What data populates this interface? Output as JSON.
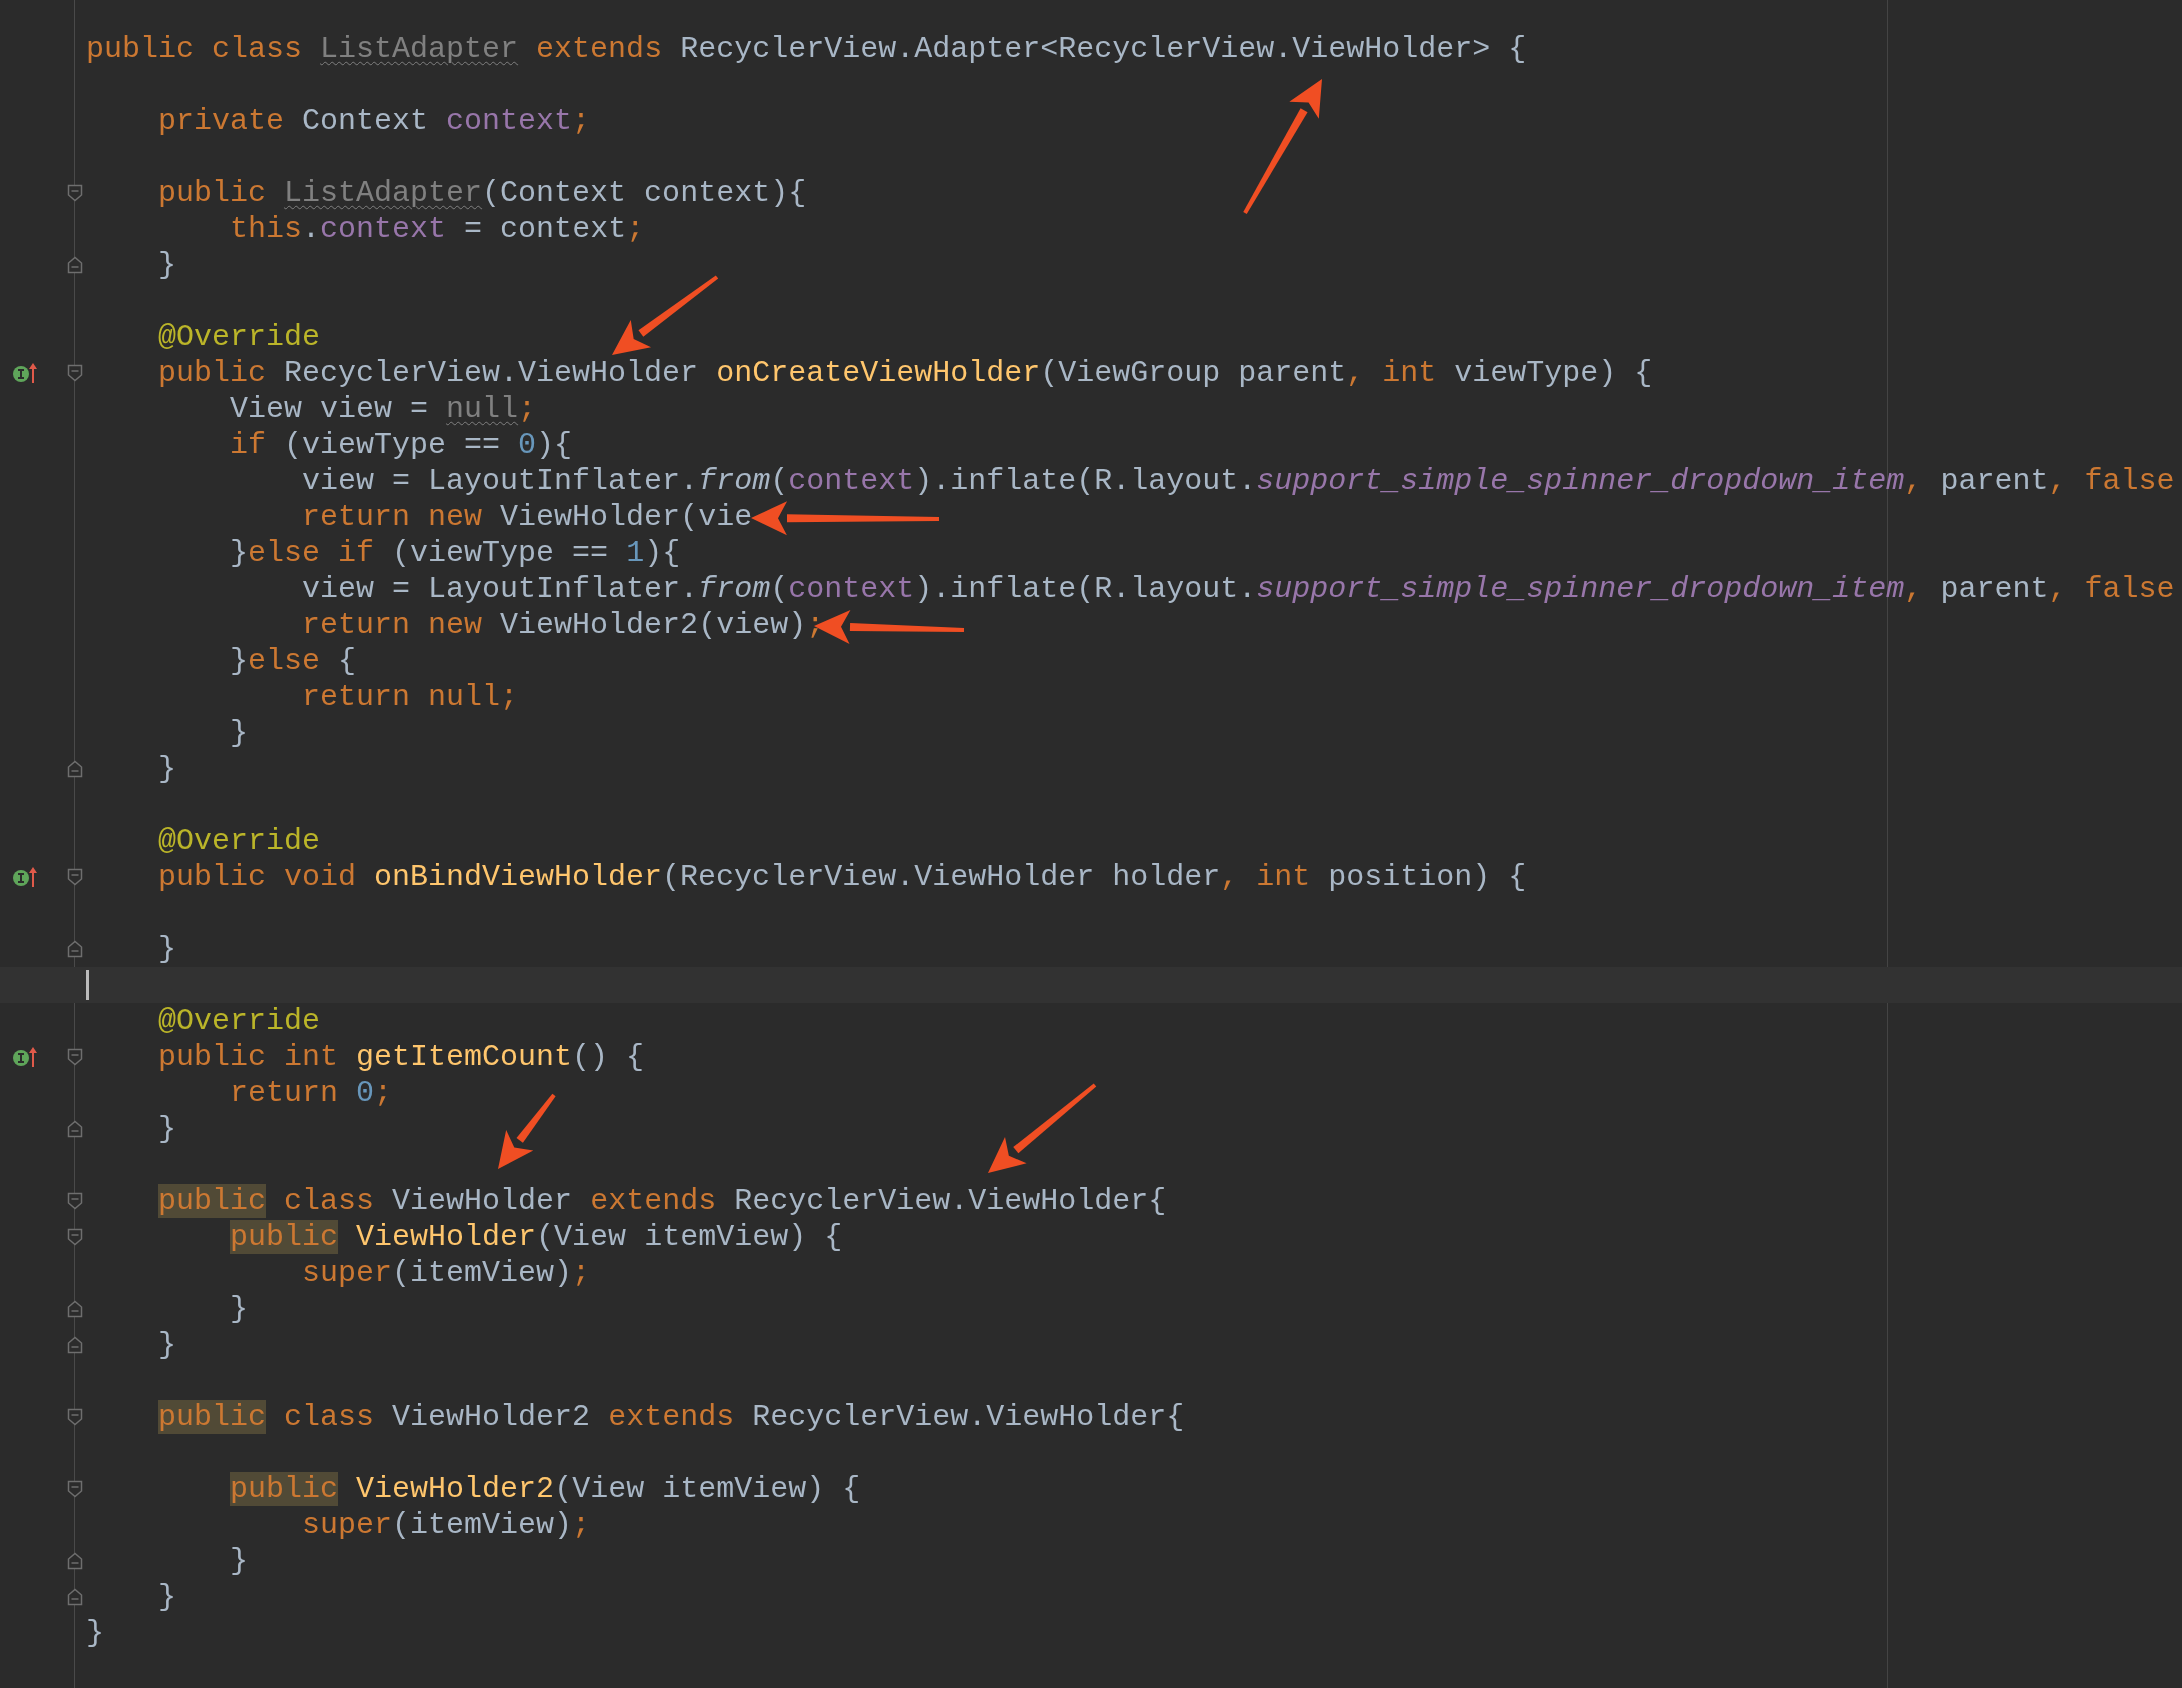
{
  "editor": {
    "lines": [
      {
        "tokens": [
          {
            "text": "public class ",
            "kind": "kw"
          },
          {
            "text": "ListAdapter",
            "kind": "unused"
          },
          {
            "text": " extends ",
            "kind": "kw"
          },
          {
            "text": "RecyclerView.Adapter<RecyclerView.ViewHolder> {",
            "kind": "plain"
          }
        ]
      },
      {
        "kind": "blank"
      },
      {
        "tokens": [
          {
            "text": "    private ",
            "kind": "kw"
          },
          {
            "text": "Context ",
            "kind": "plain"
          },
          {
            "text": "context",
            "kind": "field"
          },
          {
            "text": ";",
            "kind": "kw"
          }
        ]
      },
      {
        "kind": "blank"
      },
      {
        "fold_start": true,
        "tokens": [
          {
            "text": "    public ",
            "kind": "kw"
          },
          {
            "text": "ListAdapter",
            "kind": "unused"
          },
          {
            "text": "(Context context){",
            "kind": "plain"
          }
        ]
      },
      {
        "tokens": [
          {
            "text": "        this",
            "kind": "kw"
          },
          {
            "text": ".",
            "kind": "plain"
          },
          {
            "text": "context",
            "kind": "field"
          },
          {
            "text": " = context",
            "kind": "plain"
          },
          {
            "text": ";",
            "kind": "kw"
          }
        ]
      },
      {
        "fold_end": true,
        "tokens": [
          {
            "text": "    }",
            "kind": "plain"
          }
        ]
      },
      {
        "kind": "blank"
      },
      {
        "tokens": [
          {
            "text": "    @Override",
            "kind": "ann"
          }
        ]
      },
      {
        "override": true,
        "fold_start": true,
        "tokens": [
          {
            "text": "    public ",
            "kind": "kw"
          },
          {
            "text": "RecyclerView.ViewHolder ",
            "kind": "plain"
          },
          {
            "text": "onCreateViewHolder",
            "kind": "decl"
          },
          {
            "text": "(ViewGroup parent",
            "kind": "plain"
          },
          {
            "text": ", int ",
            "kind": "kw"
          },
          {
            "text": "viewType) {",
            "kind": "plain"
          }
        ]
      },
      {
        "tokens": [
          {
            "text": "        View view = ",
            "kind": "plain"
          },
          {
            "text": "null",
            "kind": "unused"
          },
          {
            "text": ";",
            "kind": "kw"
          }
        ]
      },
      {
        "tokens": [
          {
            "text": "        if ",
            "kind": "kw"
          },
          {
            "text": "(viewType == ",
            "kind": "plain"
          },
          {
            "text": "0",
            "kind": "num"
          },
          {
            "text": "){",
            "kind": "plain"
          }
        ]
      },
      {
        "tokens": [
          {
            "text": "            view = LayoutInflater.",
            "kind": "plain"
          },
          {
            "text": "from",
            "kind": "static"
          },
          {
            "text": "(",
            "kind": "plain"
          },
          {
            "text": "context",
            "kind": "field"
          },
          {
            "text": ").inflate(R.layout.",
            "kind": "plain"
          },
          {
            "text": "support_simple_spinner_dropdown_item",
            "kind": "static_field"
          },
          {
            "text": ", ",
            "kind": "kw"
          },
          {
            "text": "parent",
            "kind": "plain"
          },
          {
            "text": ", false",
            "kind": "kw"
          }
        ]
      },
      {
        "tokens": [
          {
            "text": "            return new ",
            "kind": "kw"
          },
          {
            "text": "ViewHolder(vie",
            "kind": "plain"
          }
        ]
      },
      {
        "tokens": [
          {
            "text": "        }",
            "kind": "plain"
          },
          {
            "text": "else if ",
            "kind": "kw"
          },
          {
            "text": "(viewType == ",
            "kind": "plain"
          },
          {
            "text": "1",
            "kind": "num"
          },
          {
            "text": "){",
            "kind": "plain"
          }
        ]
      },
      {
        "tokens": [
          {
            "text": "            view = LayoutInflater.",
            "kind": "plain"
          },
          {
            "text": "from",
            "kind": "static"
          },
          {
            "text": "(",
            "kind": "plain"
          },
          {
            "text": "context",
            "kind": "field"
          },
          {
            "text": ").inflate(R.layout.",
            "kind": "plain"
          },
          {
            "text": "support_simple_spinner_dropdown_item",
            "kind": "static_field"
          },
          {
            "text": ", ",
            "kind": "kw"
          },
          {
            "text": "parent",
            "kind": "plain"
          },
          {
            "text": ", false",
            "kind": "kw"
          }
        ]
      },
      {
        "tokens": [
          {
            "text": "            return new ",
            "kind": "kw"
          },
          {
            "text": "ViewHolder2(view)",
            "kind": "plain"
          },
          {
            "text": ";",
            "kind": "kw"
          }
        ]
      },
      {
        "tokens": [
          {
            "text": "        }",
            "kind": "plain"
          },
          {
            "text": "else ",
            "kind": "kw"
          },
          {
            "text": "{",
            "kind": "plain"
          }
        ]
      },
      {
        "tokens": [
          {
            "text": "            return null;",
            "kind": "kw"
          }
        ]
      },
      {
        "tokens": [
          {
            "text": "        }",
            "kind": "plain"
          }
        ]
      },
      {
        "fold_end": true,
        "tokens": [
          {
            "text": "    }",
            "kind": "plain"
          }
        ]
      },
      {
        "kind": "blank"
      },
      {
        "tokens": [
          {
            "text": "    @Override",
            "kind": "ann"
          }
        ]
      },
      {
        "override": true,
        "fold_start": true,
        "tokens": [
          {
            "text": "    public void ",
            "kind": "kw"
          },
          {
            "text": "onBindViewHolder",
            "kind": "decl"
          },
          {
            "text": "(RecyclerView.ViewHolder holder",
            "kind": "plain"
          },
          {
            "text": ", int ",
            "kind": "kw"
          },
          {
            "text": "position) {",
            "kind": "plain"
          }
        ]
      },
      {
        "kind": "blank"
      },
      {
        "fold_end": true,
        "tokens": [
          {
            "text": "    }",
            "kind": "plain"
          }
        ]
      },
      {
        "kind": "blank",
        "current": true
      },
      {
        "tokens": [
          {
            "text": "    @Override",
            "kind": "ann"
          }
        ]
      },
      {
        "override": true,
        "fold_start": true,
        "tokens": [
          {
            "text": "    public int ",
            "kind": "kw"
          },
          {
            "text": "getItemCount",
            "kind": "decl"
          },
          {
            "text": "() {",
            "kind": "plain"
          }
        ]
      },
      {
        "tokens": [
          {
            "text": "        return ",
            "kind": "kw"
          },
          {
            "text": "0",
            "kind": "num"
          },
          {
            "text": ";",
            "kind": "kw"
          }
        ]
      },
      {
        "fold_end": true,
        "tokens": [
          {
            "text": "    }",
            "kind": "plain"
          }
        ]
      },
      {
        "kind": "blank"
      },
      {
        "fold_start": true,
        "tokens": [
          {
            "text": "    public",
            "kind": "hl"
          },
          {
            "text": " class ",
            "kind": "kw"
          },
          {
            "text": "ViewHolder ",
            "kind": "plain"
          },
          {
            "text": "extends ",
            "kind": "kw"
          },
          {
            "text": "RecyclerView.ViewHolder{",
            "kind": "plain"
          }
        ]
      },
      {
        "fold_start": true,
        "tokens": [
          {
            "text": "        public",
            "kind": "hl"
          },
          {
            "text": " ViewHolder",
            "kind": "decl"
          },
          {
            "text": "(View itemView) {",
            "kind": "plain"
          }
        ]
      },
      {
        "tokens": [
          {
            "text": "            super",
            "kind": "kw"
          },
          {
            "text": "(itemView)",
            "kind": "plain"
          },
          {
            "text": ";",
            "kind": "kw"
          }
        ]
      },
      {
        "fold_end": true,
        "tokens": [
          {
            "text": "        }",
            "kind": "plain"
          }
        ]
      },
      {
        "fold_end": true,
        "tokens": [
          {
            "text": "    }",
            "kind": "plain"
          }
        ]
      },
      {
        "kind": "blank"
      },
      {
        "fold_start": true,
        "tokens": [
          {
            "text": "    public",
            "kind": "hl"
          },
          {
            "text": " class ",
            "kind": "kw"
          },
          {
            "text": "ViewHolder2 ",
            "kind": "plain"
          },
          {
            "text": "extends ",
            "kind": "kw"
          },
          {
            "text": "RecyclerView.ViewHolder{",
            "kind": "plain"
          }
        ]
      },
      {
        "kind": "blank"
      },
      {
        "fold_start": true,
        "tokens": [
          {
            "text": "        public",
            "kind": "hl"
          },
          {
            "text": " ViewHolder2",
            "kind": "decl"
          },
          {
            "text": "(View itemView) {",
            "kind": "plain"
          }
        ]
      },
      {
        "tokens": [
          {
            "text": "            super",
            "kind": "kw"
          },
          {
            "text": "(itemView)",
            "kind": "plain"
          },
          {
            "text": ";",
            "kind": "kw"
          }
        ]
      },
      {
        "fold_end": true,
        "tokens": [
          {
            "text": "        }",
            "kind": "plain"
          }
        ]
      },
      {
        "fold_end": true,
        "tokens": [
          {
            "text": "    }",
            "kind": "plain"
          }
        ]
      },
      {
        "tokens": [
          {
            "text": "}",
            "kind": "plain"
          }
        ]
      }
    ]
  }
}
